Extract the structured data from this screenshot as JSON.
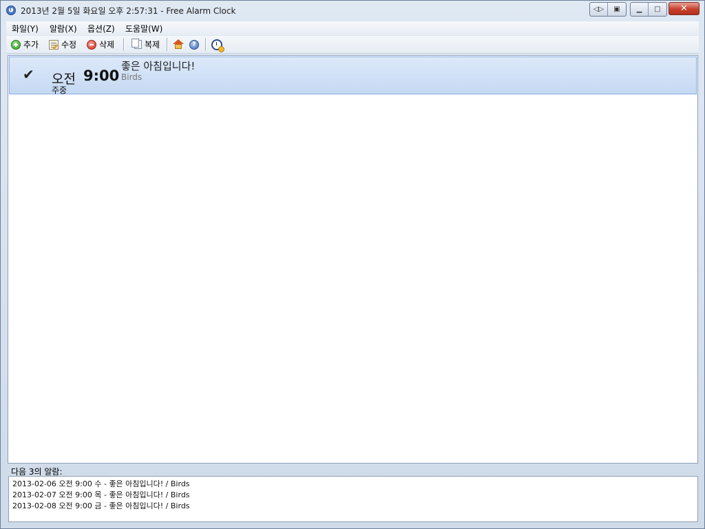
{
  "window": {
    "title": "2013년 2월 5일 화요일 오후 2:57:31 - Free Alarm Clock"
  },
  "titlebar_buttons": {
    "nav_icon": "back-forward-icon",
    "pin_icon": "clipboard-icon",
    "minimize_icon": "minimize-icon",
    "maximize_icon": "maximize-icon",
    "close_label": "✕"
  },
  "menu": {
    "file": "화일(Y)",
    "alarm": "알람(X)",
    "options": "옵션(Z)",
    "help": "도움말(W)"
  },
  "toolbar": {
    "add": "추가",
    "edit": "수정",
    "delete": "삭제",
    "clone": "복제",
    "home_icon": "home-icon",
    "help_icon": "help-icon",
    "clock_icon": "alarm-clock-icon"
  },
  "alarms": [
    {
      "enabled": true,
      "ampm": "오전",
      "time": "9:00",
      "days": "주중",
      "message": "좋은 아침입니다!",
      "sound": "Birds"
    }
  ],
  "upcoming": {
    "label": "다음 3의 알람:",
    "items": [
      "2013-02-06 오전 9:00 수 - 좋은 아침입니다! / Birds",
      "2013-02-07 오전 9:00 목 - 좋은 아침입니다! / Birds",
      "2013-02-08 오전 9:00 금 - 좋은 아침입니다! / Birds"
    ]
  }
}
